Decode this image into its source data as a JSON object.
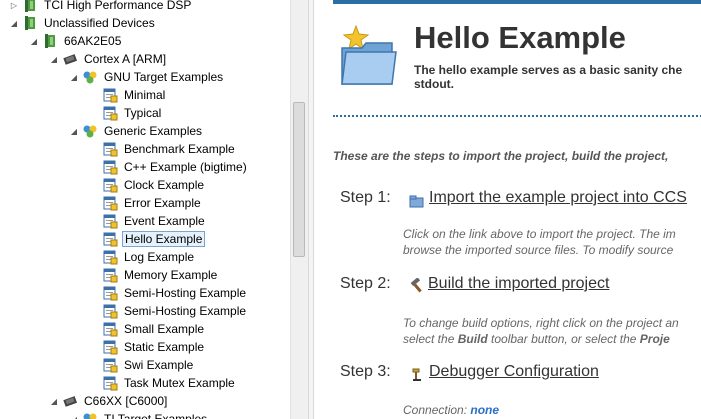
{
  "tree": {
    "items": [
      {
        "label": "TCI High Performance DSP",
        "twisty": "▷",
        "icon": "device-folder-icon"
      },
      {
        "label": "Unclassified Devices",
        "twisty": "◢",
        "icon": "device-folder-icon"
      },
      {
        "label": "66AK2E05",
        "twisty": "◢",
        "icon": "device-folder-icon"
      },
      {
        "label": "Cortex A [ARM]",
        "twisty": "◢",
        "icon": "chip-icon"
      },
      {
        "label": "GNU Target Examples",
        "twisty": "◢",
        "icon": "example-category-icon"
      },
      {
        "label": "Minimal",
        "twisty": "",
        "icon": "template-icon"
      },
      {
        "label": "Typical",
        "twisty": "",
        "icon": "template-icon"
      },
      {
        "label": "Generic Examples",
        "twisty": "◢",
        "icon": "example-category-icon"
      },
      {
        "label": "Benchmark Example",
        "twisty": "",
        "icon": "template-icon"
      },
      {
        "label": "C++ Example (bigtime)",
        "twisty": "",
        "icon": "template-icon"
      },
      {
        "label": "Clock Example",
        "twisty": "",
        "icon": "template-icon"
      },
      {
        "label": "Error Example",
        "twisty": "",
        "icon": "template-icon"
      },
      {
        "label": "Event Example",
        "twisty": "",
        "icon": "template-icon"
      },
      {
        "label": "Hello Example",
        "twisty": "",
        "icon": "template-icon",
        "selected": true
      },
      {
        "label": "Log Example",
        "twisty": "",
        "icon": "template-icon"
      },
      {
        "label": "Memory Example",
        "twisty": "",
        "icon": "template-icon"
      },
      {
        "label": "Semi-Hosting Example",
        "twisty": "",
        "icon": "template-icon"
      },
      {
        "label": "Semi-Hosting Example",
        "twisty": "",
        "icon": "template-icon"
      },
      {
        "label": "Small Example",
        "twisty": "",
        "icon": "template-icon"
      },
      {
        "label": "Static Example",
        "twisty": "",
        "icon": "template-icon"
      },
      {
        "label": "Swi Example",
        "twisty": "",
        "icon": "template-icon"
      },
      {
        "label": "Task Mutex Example",
        "twisty": "",
        "icon": "template-icon"
      },
      {
        "label": "C66XX [C6000]",
        "twisty": "◢",
        "icon": "chip-icon"
      },
      {
        "label": "TI Target Examples",
        "twisty": "◢",
        "icon": "example-category-icon"
      }
    ]
  },
  "content": {
    "title": "Hello Example",
    "description_line1": "The hello example serves as a basic sanity che",
    "description_line2": "stdout.",
    "intro": "These are the steps to import the project, build the project,",
    "steps": [
      {
        "label": "Step 1:",
        "link": "Import the example project into CCS",
        "icon": "import-project-icon",
        "note_line1": "Click on the link above to import the project. The im",
        "note_line2": "browse the imported source files. To modify source"
      },
      {
        "label": "Step 2:",
        "link": "Build the imported project",
        "icon": "hammer-icon",
        "note_line1": "To change build options, right click on the project an",
        "note_line2_a": "select the ",
        "note_line2_b": "Build",
        "note_line2_c": " toolbar button, or select the ",
        "note_line2_d": "Proje"
      },
      {
        "label": "Step 3:",
        "link": "Debugger Configuration",
        "icon": "debugger-config-icon",
        "connection_label": "Connection: ",
        "connection_value": "none"
      }
    ]
  },
  "colors": {
    "accent": "#2b6ea3",
    "link_blue": "#2a6fc9",
    "selection": "#e5f1fb"
  }
}
